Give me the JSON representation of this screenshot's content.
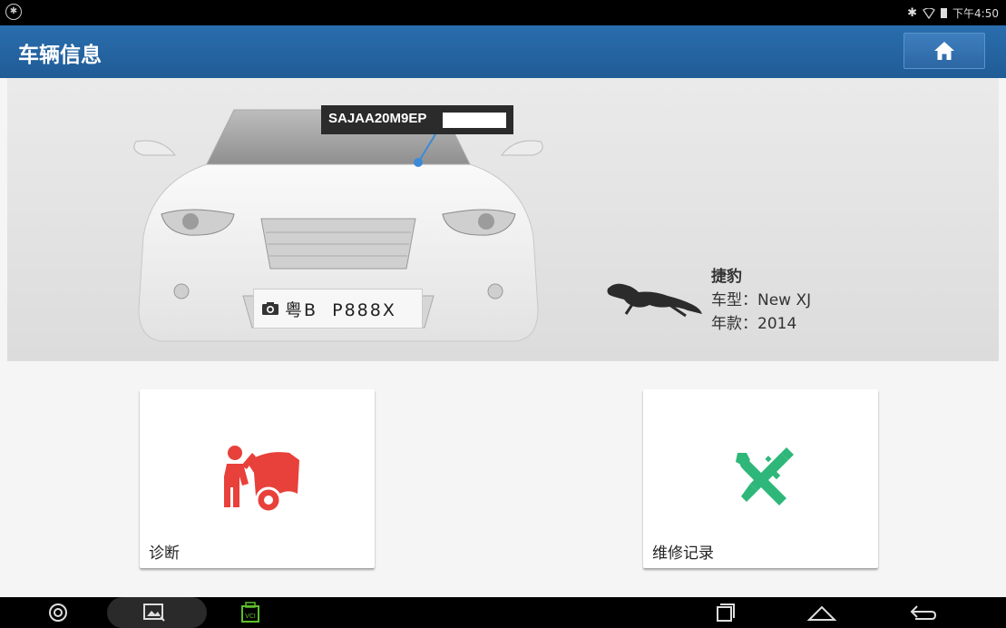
{
  "statusbar": {
    "time": "下午4:50"
  },
  "header": {
    "title": "车辆信息"
  },
  "vehicle": {
    "vin": "SAJAA20M9EP",
    "plate": "粤B  P888X",
    "brand": "捷豹",
    "model_label": "车型：",
    "model": "New XJ",
    "year_label": "年款：",
    "year": "2014"
  },
  "cards": {
    "diagnosis": {
      "label": "诊断"
    },
    "repair_records": {
      "label": "维修记录"
    }
  },
  "navbar": {
    "vci_label": "VCI"
  },
  "colors": {
    "header": "#205c96",
    "diag_icon": "#e8403a",
    "repair_icon": "#2fb77a"
  }
}
